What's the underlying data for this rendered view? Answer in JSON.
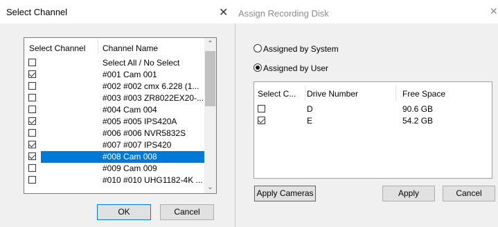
{
  "select_channel": {
    "title": "Select Channel",
    "close_glyph": "✕",
    "columns": [
      "Select Channel",
      "Channel Name"
    ],
    "rows": [
      {
        "checked": false,
        "name": "Select All / No Select",
        "selected": false
      },
      {
        "checked": true,
        "name": "#001 Cam 001",
        "selected": false
      },
      {
        "checked": false,
        "name": "#002 #002 cmx 6.228 (1...",
        "selected": false
      },
      {
        "checked": false,
        "name": "#003 #003 ZR8022EX20-...",
        "selected": false
      },
      {
        "checked": false,
        "name": "#004 Cam 004",
        "selected": false
      },
      {
        "checked": true,
        "name": "#005 #005 IPS420A",
        "selected": false
      },
      {
        "checked": false,
        "name": "#006 #006 NVR5832S",
        "selected": false
      },
      {
        "checked": true,
        "name": "#007 #007 IPS420",
        "selected": false
      },
      {
        "checked": true,
        "name": "#008 Cam 008",
        "selected": true
      },
      {
        "checked": false,
        "name": "#009 Cam 009",
        "selected": false
      },
      {
        "checked": false,
        "name": "#010 #010 UHG1182-4K ...",
        "selected": false
      }
    ],
    "ok_label": "OK",
    "cancel_label": "Cancel"
  },
  "assign_disk": {
    "title": "Assign Recording Disk",
    "close_glyph": "✕",
    "radio_system": "Assigned by System",
    "radio_user": "Assigned by User",
    "selected_radio": "user",
    "columns": [
      "Select C...",
      "Drive Number",
      "Free Space"
    ],
    "disks": [
      {
        "checked": false,
        "drive": "D",
        "free": "90.6 GB"
      },
      {
        "checked": true,
        "drive": "E",
        "free": "54.2 GB"
      }
    ],
    "apply_cameras_label": "Apply Cameras",
    "apply_label": "Apply",
    "cancel_label": "Cancel"
  },
  "colors": {
    "selection": "#0078d7",
    "dialog_bg": "#f0f0f0",
    "disabled_title": "#8c8c8c"
  }
}
